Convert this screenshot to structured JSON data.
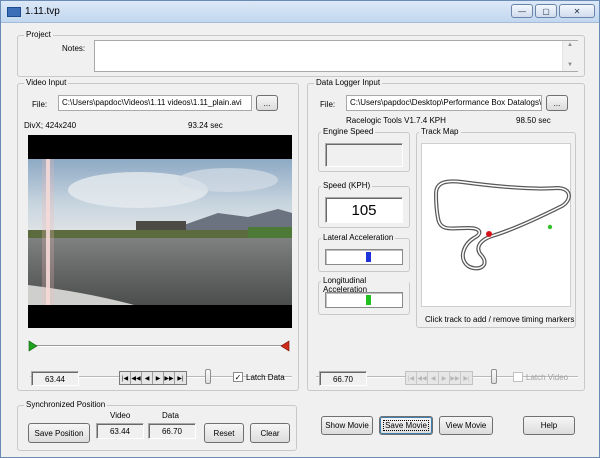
{
  "window": {
    "title": "1.11.tvp",
    "minimize_glyph": "—",
    "maximize_glyph": "▢",
    "close_glyph": "✕"
  },
  "project": {
    "legend": "Project",
    "notes_label": "Notes:",
    "notes_value": ""
  },
  "video_input": {
    "legend": "Video Input",
    "file_label": "File:",
    "file_path": "C:\\Users\\papdoc\\Videos\\1.11 videos\\1.11_plain.avi",
    "browse_label": "...",
    "codec_info": "DivX; 424x240",
    "duration": "93.24 sec",
    "position_value": "63.44",
    "slider_fraction": 0.68,
    "latch_label": "Latch Data",
    "latch_checked": "✓"
  },
  "data_logger": {
    "legend": "Data Logger Input",
    "file_label": "File:",
    "file_path": "C:\\Users\\papdoc\\Desktop\\Performance Box Datalogs\\",
    "browse_label": "...",
    "source_info": "Racelogic Tools V1.7.4 KPH",
    "duration": "98.50 sec",
    "engine_speed_label": "Engine Speed",
    "engine_speed_value": "",
    "speed_label": "Speed (KPH)",
    "speed_value": "105",
    "lateral_label": "Lateral Acceleration",
    "lateral_fraction": 0.55,
    "longitudinal_label": "Longitudinal Acceleration",
    "longitudinal_fraction": 0.55,
    "track_map_label": "Track Map",
    "track_map_hint": "Click track to add / remove timing markers",
    "position_value": "66.70",
    "slider_fraction": 0.68,
    "latch_label": "Latch Video"
  },
  "sync": {
    "legend": "Synchronized Position",
    "video_header": "Video",
    "data_header": "Data",
    "video_value": "63.44",
    "data_value": "66.70",
    "save_position_label": "Save Position",
    "reset_label": "Reset",
    "clear_label": "Clear"
  },
  "footer": {
    "show_movie_label": "Show Movie",
    "save_movie_label": "Save Movie",
    "view_movie_label": "View Movie",
    "help_label": "Help"
  },
  "transport_icons": [
    "skip-start-icon",
    "step-back-icon",
    "rewind-icon",
    "play-icon",
    "fast-forward-icon",
    "skip-end-icon"
  ],
  "colors": {
    "start_marker": "#1fa31f",
    "end_marker": "#d22a1a",
    "gauge_lateral": "#1d35d8",
    "gauge_longitudinal": "#21c11f",
    "track_marker_red": "#d5121a",
    "track_marker_green": "#36c12b"
  }
}
